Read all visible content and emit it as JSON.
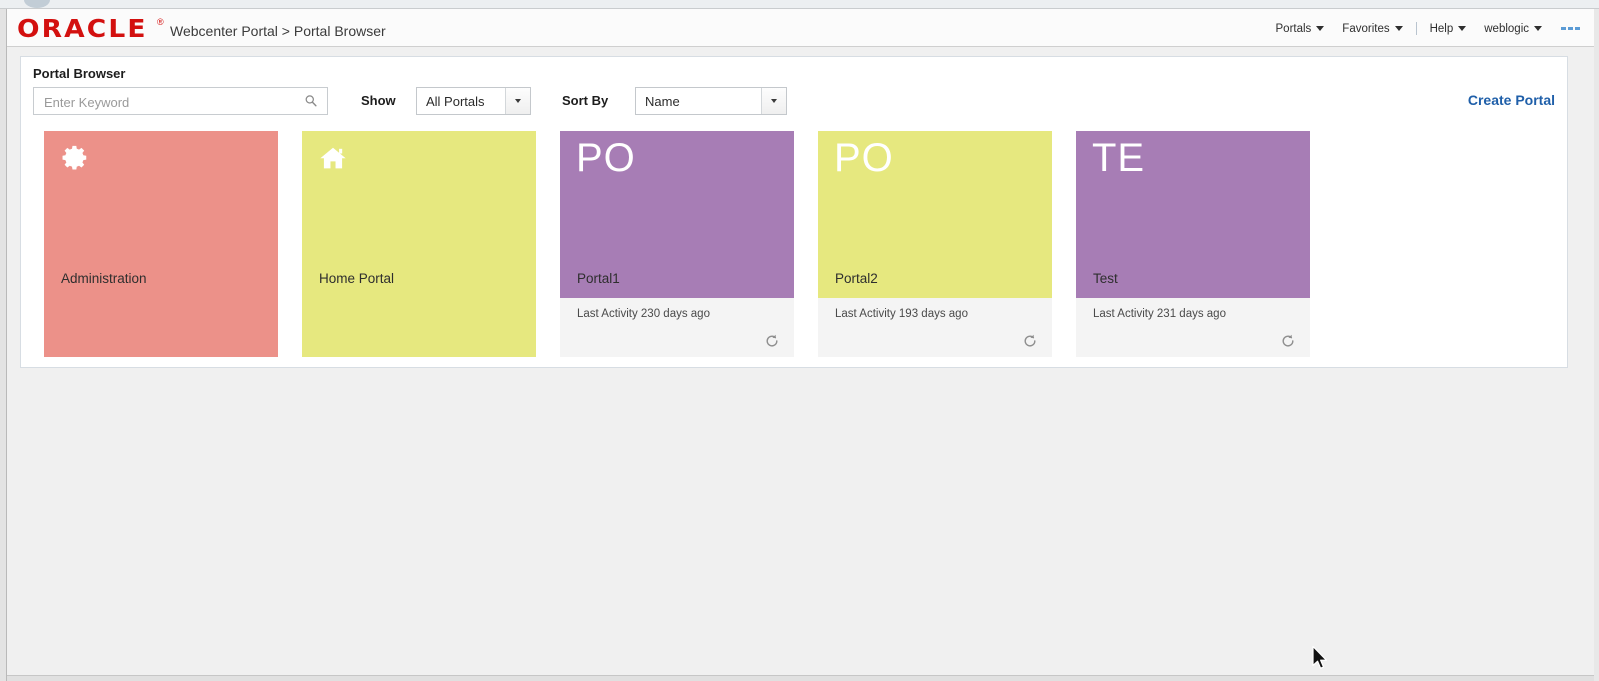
{
  "header": {
    "logo_text": "ORACLE",
    "logo_mark": "®",
    "breadcrumb": "Webcenter Portal > Portal Browser",
    "brand_color": "#d3100f",
    "nav": [
      {
        "label": "Portals",
        "has_caret": true
      },
      {
        "label": "Favorites",
        "has_caret": true
      },
      {
        "label": "Help",
        "has_caret": true
      },
      {
        "label": "weblogic",
        "has_caret": true
      }
    ],
    "more_icon": "three-dashes-icon",
    "more_icon_color": "#5b9bd5"
  },
  "panel": {
    "title": "Portal Browser"
  },
  "toolbar": {
    "search": {
      "placeholder": "Enter Keyword",
      "value": "",
      "icon": "search-icon"
    },
    "show": {
      "label": "Show",
      "selected": "All Portals"
    },
    "sort": {
      "label": "Sort By",
      "selected": "Name"
    },
    "create_portal_label": "Create Portal",
    "create_portal_color": "#1f5fa9"
  },
  "tiles": [
    {
      "name": "Administration",
      "kind": "icon",
      "icon": "gear-icon",
      "color": "#ec9189",
      "has_footer": false,
      "activity": ""
    },
    {
      "name": "Home Portal",
      "kind": "icon",
      "icon": "home-icon",
      "color": "#e6e87f",
      "has_footer": false,
      "activity": ""
    },
    {
      "name": "Portal1",
      "kind": "initials",
      "initials": "PO",
      "color": "#a77db5",
      "has_footer": true,
      "activity": "Last Activity 230 days ago",
      "refresh_icon": "refresh-icon"
    },
    {
      "name": "Portal2",
      "kind": "initials",
      "initials": "PO",
      "color": "#e6e87f",
      "has_footer": true,
      "activity": "Last Activity 193 days ago",
      "refresh_icon": "refresh-icon"
    },
    {
      "name": "Test",
      "kind": "initials",
      "initials": "TE",
      "color": "#a77db5",
      "has_footer": true,
      "activity": "Last Activity 231 days ago",
      "refresh_icon": "refresh-icon"
    }
  ]
}
